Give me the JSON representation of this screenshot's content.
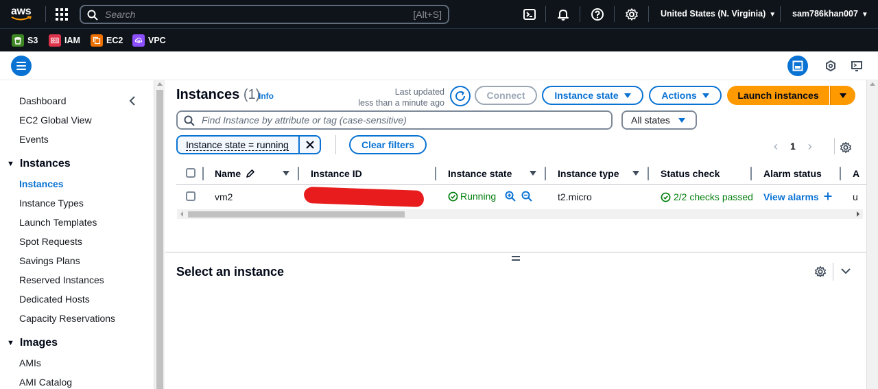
{
  "topnav": {
    "logo_text": "aws",
    "search_placeholder": "Search",
    "search_shortcut": "[Alt+S]",
    "region": "United States (N. Virginia)",
    "user": "sam786khan007"
  },
  "favorites": [
    {
      "label": "S3",
      "color": "#3f8624",
      "icon": "s3-icon"
    },
    {
      "label": "IAM",
      "color": "#dd344c",
      "icon": "iam-icon"
    },
    {
      "label": "EC2",
      "color": "#ed7100",
      "icon": "ec2-icon"
    },
    {
      "label": "VPC",
      "color": "#8c4fff",
      "icon": "vpc-icon"
    }
  ],
  "sidebar": {
    "top_items": [
      "Dashboard",
      "EC2 Global View",
      "Events"
    ],
    "sections": [
      {
        "title": "Instances",
        "items": [
          "Instances",
          "Instance Types",
          "Launch Templates",
          "Spot Requests",
          "Savings Plans",
          "Reserved Instances",
          "Dedicated Hosts",
          "Capacity Reservations"
        ],
        "active": "Instances"
      },
      {
        "title": "Images",
        "items": [
          "AMIs",
          "AMI Catalog"
        ]
      }
    ]
  },
  "main": {
    "title": "Instances",
    "count": "(1)",
    "info": "Info",
    "last_updated_line1": "Last updated",
    "last_updated_line2": "less than a minute ago",
    "connect": "Connect",
    "instance_state": "Instance state",
    "actions": "Actions",
    "launch": "Launch instances",
    "filter_placeholder": "Find Instance by attribute or tag (case-sensitive)",
    "states_select": "All states",
    "filter_token": "Instance state = running",
    "clear_filters": "Clear filters",
    "page": "1"
  },
  "table": {
    "columns": [
      "Name",
      "Instance ID",
      "Instance state",
      "Instance type",
      "Status check",
      "Alarm status",
      "A"
    ],
    "rows": [
      {
        "name": "vm2",
        "instance_id": "",
        "state": "Running",
        "type": "t2.micro",
        "status_check": "2/2 checks passed",
        "alarm": "View alarms",
        "extra": "u"
      }
    ]
  },
  "details": {
    "title": "Select an instance"
  },
  "colors": {
    "accent": "#0972d3",
    "primary": "#ff9900",
    "success": "#037f0c",
    "nav_bg": "#0f141a"
  }
}
